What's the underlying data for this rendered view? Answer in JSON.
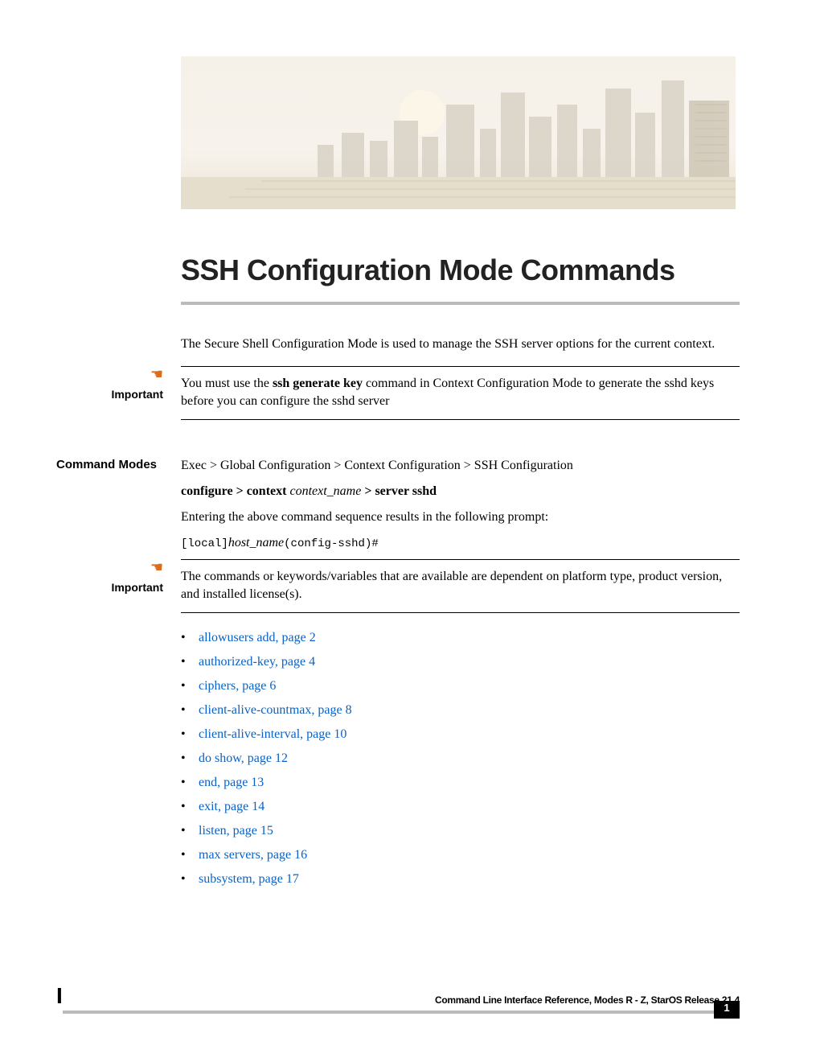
{
  "title": "SSH Configuration Mode Commands",
  "intro": "The Secure Shell Configuration Mode is used to manage the SSH server options for the current context.",
  "important_label": "Important",
  "note1_prefix": "You must use the ",
  "note1_bold": "ssh generate key",
  "note1_suffix": " command in Context Configuration Mode to generate the sshd keys before you can configure the sshd server",
  "command_modes_label": "Command Modes",
  "breadcrumbs": "Exec > Global Configuration > Context Configuration > SSH Configuration",
  "cfg_prefix": "configure > context ",
  "cfg_var": "context_name",
  "cfg_suffix": " > server sshd",
  "prompt_intro": "Entering the above command sequence results in the following prompt:",
  "prompt_local": "[local]",
  "prompt_host": "host_name",
  "prompt_tail": "(config-sshd)#",
  "note2": "The commands or keywords/variables that are available are dependent on platform type, product version, and installed license(s).",
  "toc": [
    {
      "label": "allowusers add,  page  2"
    },
    {
      "label": "authorized-key,  page  4"
    },
    {
      "label": "ciphers,  page  6"
    },
    {
      "label": "client-alive-countmax,  page  8"
    },
    {
      "label": "client-alive-interval,  page  10"
    },
    {
      "label": "do show,  page  12"
    },
    {
      "label": "end,  page  13"
    },
    {
      "label": "exit,  page  14"
    },
    {
      "label": "listen,  page  15"
    },
    {
      "label": "max servers,  page  16"
    },
    {
      "label": "subsystem,  page  17"
    }
  ],
  "footer_title": "Command Line Interface Reference, Modes R - Z, StarOS Release 21.4",
  "page_number": "1",
  "oldoc_mark": "I"
}
